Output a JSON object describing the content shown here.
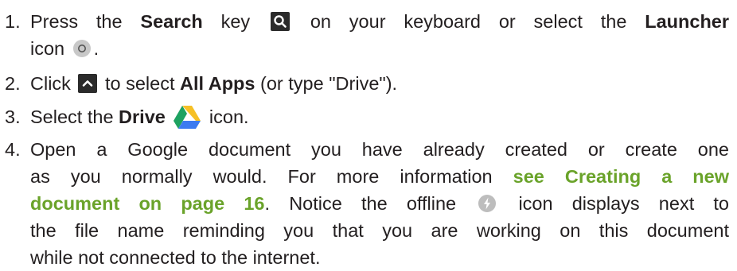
{
  "steps": [
    {
      "num": "1.",
      "lines": {
        "l1_pre": "Press the",
        "l1_b1": "Search",
        "l1_mid": "key",
        "l1_post": "on your keyboard or select the",
        "l1_b2": "Launcher",
        "l2_pre": "icon",
        "l2_post": "."
      },
      "icons": [
        "search-key-icon",
        "launcher-icon"
      ]
    },
    {
      "num": "2.",
      "lines": {
        "pre": "Click",
        "mid": "to select",
        "bold": "All Apps",
        "post": "(or type \"Drive\")."
      },
      "icons": [
        "chevron-up-icon"
      ]
    },
    {
      "num": "3.",
      "lines": {
        "pre": "Select the",
        "bold": "Drive",
        "post": "icon."
      },
      "icons": [
        "google-drive-icon"
      ]
    },
    {
      "num": "4.",
      "lines": {
        "l1": "Open a Google document you have already created or create one",
        "l2_pre": "as you normally would. For more information",
        "l2_link": "see Creating a new",
        "l3_link": "document on page 16",
        "l3_pre": ". Notice the offline",
        "l3_post": "icon displays next to",
        "l4": "the file name reminding you that you are working on this document",
        "l5": "while not connected to the internet."
      },
      "icons": [
        "offline-icon"
      ]
    }
  ],
  "colors": {
    "text": "#231f20",
    "link": "#6aa32a",
    "key_bg": "#2b2b2b",
    "launcher": "#c8c8c8",
    "offline": "#bdbdbd"
  }
}
